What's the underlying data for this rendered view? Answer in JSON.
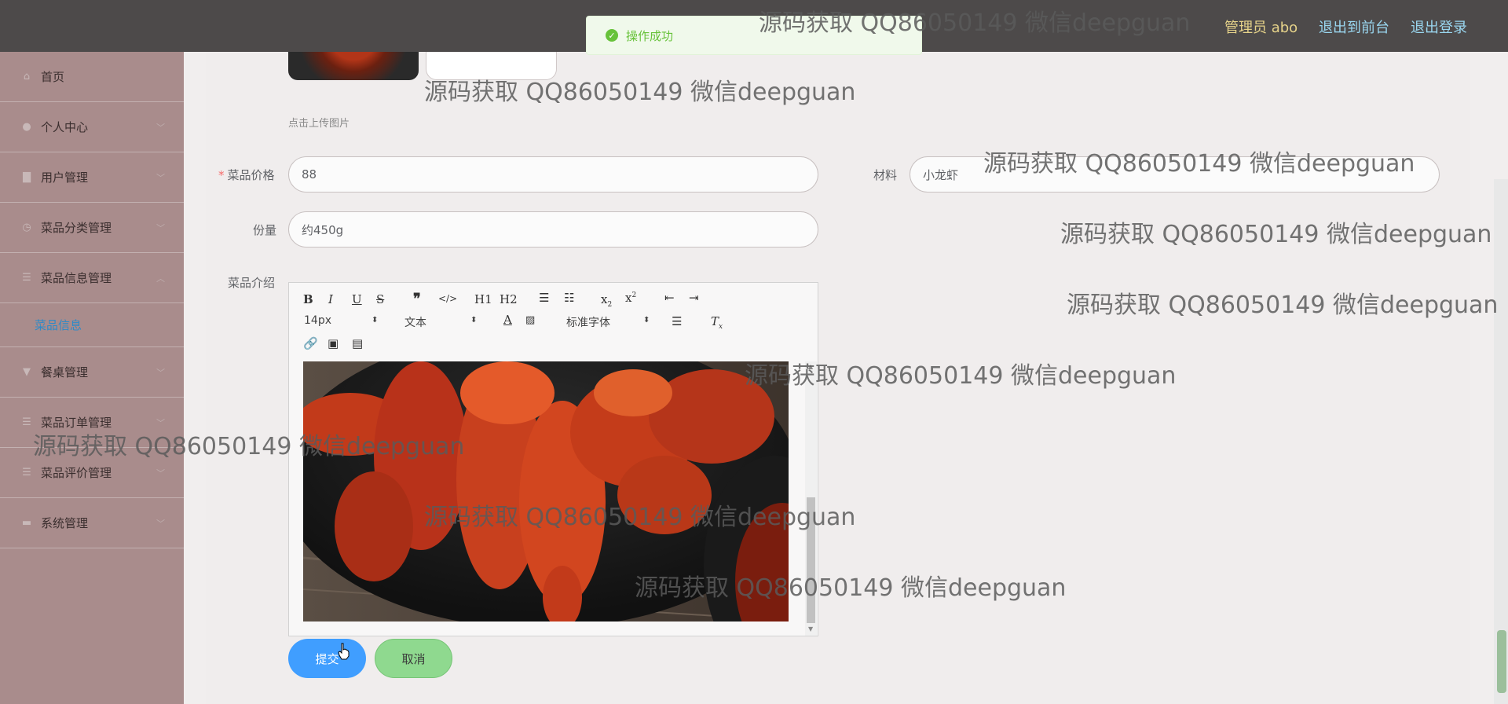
{
  "header": {
    "user_label": "管理员 abo",
    "front_link": "退出到前台",
    "logout_link": "退出登录"
  },
  "toast": {
    "message": "操作成功",
    "icon": "check-circle-icon",
    "color": "#67c23a"
  },
  "sidebar": {
    "items": [
      {
        "label": "首页",
        "icon": "home-icon",
        "has_arrow": false
      },
      {
        "label": "个人中心",
        "icon": "user-icon",
        "has_arrow": true
      },
      {
        "label": "用户管理",
        "icon": "users-icon",
        "has_arrow": true
      },
      {
        "label": "菜品分类管理",
        "icon": "category-icon",
        "has_arrow": true
      },
      {
        "label": "菜品信息管理",
        "icon": "list-icon",
        "has_arrow": true,
        "expanded": true
      },
      {
        "label": "餐桌管理",
        "icon": "table-icon",
        "has_arrow": true
      },
      {
        "label": "菜品订单管理",
        "icon": "order-icon",
        "has_arrow": true
      },
      {
        "label": "菜品评价管理",
        "icon": "review-icon",
        "has_arrow": true
      },
      {
        "label": "系统管理",
        "icon": "settings-icon",
        "has_arrow": true
      }
    ],
    "subitems": {
      "dish_info": "菜品信息"
    }
  },
  "form": {
    "upload_hint": "点击上传图片",
    "price_label": "菜品价格",
    "price_value": "88",
    "material_label": "材料",
    "material_value": "小龙虾",
    "portion_label": "份量",
    "portion_value": "约450g",
    "intro_label": "菜品介绍",
    "required_mark": "*"
  },
  "editor": {
    "font_size": "14px",
    "text_type": "文本",
    "font_family": "标准字体",
    "h1": "H1",
    "h2": "H2"
  },
  "buttons": {
    "submit": "提交",
    "cancel": "取消"
  },
  "watermark": "源码获取 QQ86050149 微信deepguan",
  "colors": {
    "topbar": "#4d4a4a",
    "sidebar": "#a98c8c",
    "submit": "#409eff",
    "cancel": "#8fd98f",
    "active_submenu": "#2f8ac7"
  }
}
